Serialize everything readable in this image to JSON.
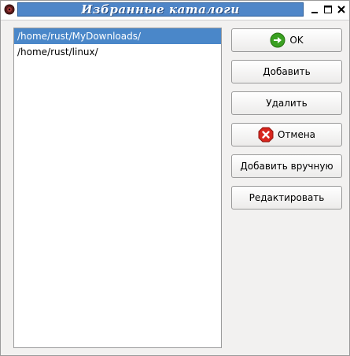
{
  "window": {
    "title": "Избранные каталоги"
  },
  "titlebar": {
    "icons": [
      "app-menu-icon",
      "minimize-icon",
      "maximize-icon",
      "close-icon"
    ]
  },
  "directories": [
    {
      "path": "/home/rust/MyDownloads/",
      "selected": true
    },
    {
      "path": "/home/rust/linux/",
      "selected": false
    }
  ],
  "buttons": {
    "ok": "OK",
    "add": "Добавить",
    "delete": "Удалить",
    "cancel": "Отмена",
    "add_manual": "Добавить вручную",
    "edit": "Редактировать"
  },
  "colors": {
    "selection": "#4a87c9",
    "title_bar": "#4f86c8",
    "ok_icon": "#3aa021",
    "cancel_icon": "#d8261e"
  }
}
